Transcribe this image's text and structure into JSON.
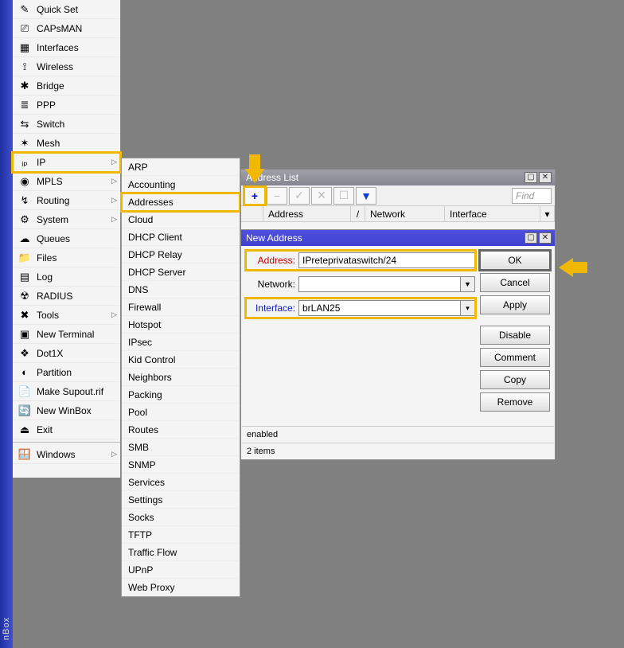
{
  "brand": "nBox",
  "sidebar": {
    "items": [
      {
        "label": "Quick Set",
        "icon": "✎",
        "caret": false
      },
      {
        "label": "CAPsMAN",
        "icon": "⎚",
        "caret": false
      },
      {
        "label": "Interfaces",
        "icon": "▦",
        "caret": false
      },
      {
        "label": "Wireless",
        "icon": "⟟",
        "caret": false
      },
      {
        "label": "Bridge",
        "icon": "✱",
        "caret": false
      },
      {
        "label": "PPP",
        "icon": "≣",
        "caret": false
      },
      {
        "label": "Switch",
        "icon": "⇆",
        "caret": false
      },
      {
        "label": "Mesh",
        "icon": "✶",
        "caret": false
      },
      {
        "label": "IP",
        "icon": "ᵢₚ",
        "caret": true,
        "highlight": true
      },
      {
        "label": "MPLS",
        "icon": "◉",
        "caret": true
      },
      {
        "label": "Routing",
        "icon": "↯",
        "caret": true
      },
      {
        "label": "System",
        "icon": "⚙",
        "caret": true
      },
      {
        "label": "Queues",
        "icon": "☁",
        "caret": false
      },
      {
        "label": "Files",
        "icon": "📁",
        "caret": false
      },
      {
        "label": "Log",
        "icon": "▤",
        "caret": false
      },
      {
        "label": "RADIUS",
        "icon": "☢",
        "caret": false
      },
      {
        "label": "Tools",
        "icon": "✖",
        "caret": true
      },
      {
        "label": "New Terminal",
        "icon": "▣",
        "caret": false
      },
      {
        "label": "Dot1X",
        "icon": "❖",
        "caret": false
      },
      {
        "label": "Partition",
        "icon": "◐",
        "caret": false
      },
      {
        "label": "Make Supout.rif",
        "icon": "📄",
        "caret": false
      },
      {
        "label": "New WinBox",
        "icon": "🔄",
        "caret": false
      },
      {
        "label": "Exit",
        "icon": "⏏",
        "caret": false
      }
    ],
    "windows": {
      "label": "Windows",
      "icon": "🪟",
      "caret": true
    }
  },
  "submenu": {
    "items": [
      "ARP",
      "Accounting",
      "Addresses",
      "Cloud",
      "DHCP Client",
      "DHCP Relay",
      "DHCP Server",
      "DNS",
      "Firewall",
      "Hotspot",
      "IPsec",
      "Kid Control",
      "Neighbors",
      "Packing",
      "Pool",
      "Routes",
      "SMB",
      "SNMP",
      "Services",
      "Settings",
      "Socks",
      "TFTP",
      "Traffic Flow",
      "UPnP",
      "Web Proxy"
    ],
    "highlight_index": 2
  },
  "addr_list": {
    "title": "Address List",
    "find_placeholder": "Find",
    "columns": [
      "Address",
      "Network",
      "Interface"
    ],
    "plus": "+"
  },
  "new_addr": {
    "title": "New Address",
    "rows": {
      "address": {
        "label": "Address:",
        "value": "IPreteprivataswitch/24"
      },
      "network": {
        "label": "Network:",
        "value": ""
      },
      "interface": {
        "label": "Interface:",
        "value": "brLAN25"
      }
    },
    "buttons": [
      "OK",
      "Cancel",
      "Apply",
      "Disable",
      "Comment",
      "Copy",
      "Remove"
    ],
    "status": "enabled",
    "footer": "2 items"
  }
}
